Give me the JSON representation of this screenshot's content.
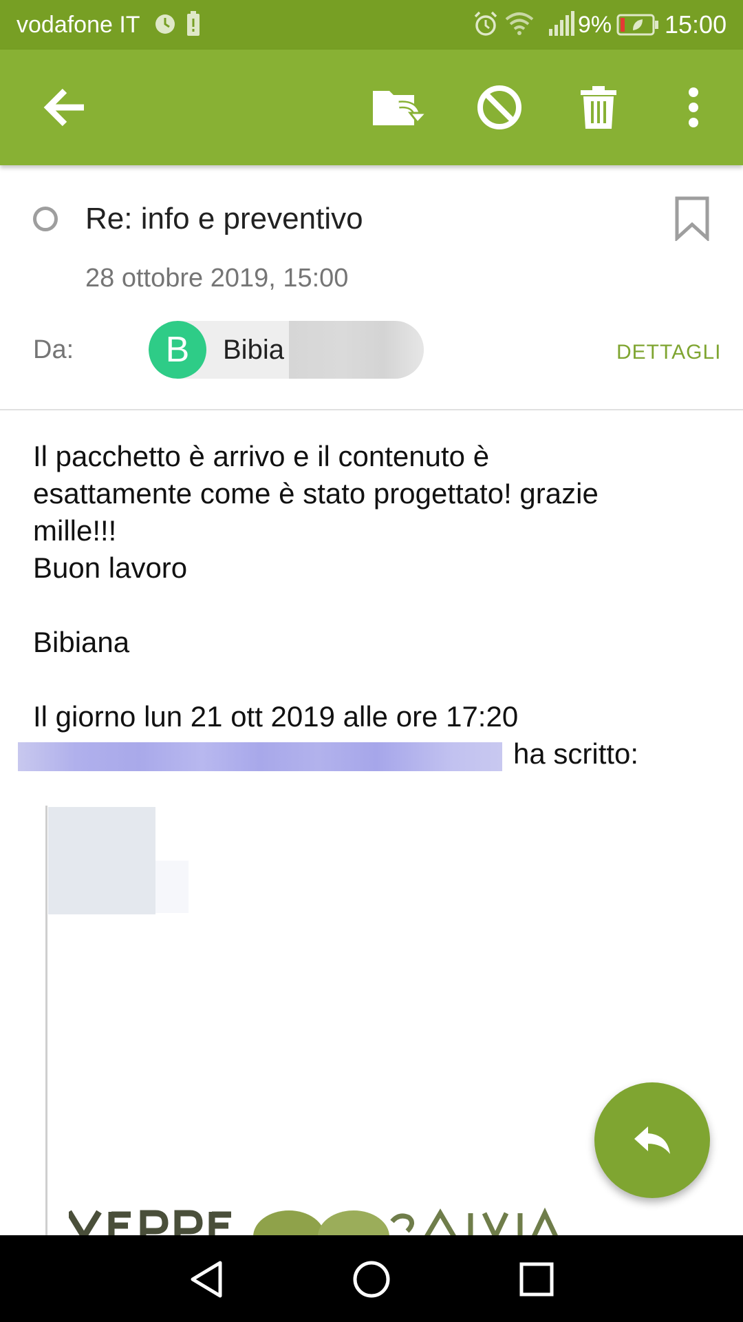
{
  "status_bar": {
    "carrier": "vodafone IT",
    "battery_percent": "9%",
    "time": "15:00",
    "icons": [
      "alarm-icon",
      "battery-alert-icon",
      "alarm-clock-icon",
      "wifi-icon",
      "signal-icon",
      "battery-icon"
    ]
  },
  "app_bar": {
    "actions": [
      "back-icon",
      "move-folder-icon",
      "block-spam-icon",
      "delete-icon",
      "more-options-icon"
    ],
    "background_color": "#88b134"
  },
  "message": {
    "subject": "Re: info e preventivo",
    "date": "28 ottobre 2019, 15:00",
    "from_label": "Da:",
    "sender_initial": "B",
    "sender_name": "Bibia",
    "details_label": "DETTAGLI",
    "body": {
      "line1": "Il pacchetto è arrivo e il contenuto è",
      "line2": "esattamente come è stato progettato! grazie",
      "line3": "mille!!!",
      "line4": "Buon lavoro",
      "signature": "Bibiana",
      "quote_intro": "Il giorno lun 21 ott 2019 alle ore 17:20",
      "wrote": "ha scritto:"
    }
  },
  "fab": {
    "icon": "reply-icon",
    "color": "#7fa531"
  },
  "nav_bar": {
    "buttons": [
      "back-triangle-icon",
      "home-circle-icon",
      "recents-square-icon"
    ]
  }
}
